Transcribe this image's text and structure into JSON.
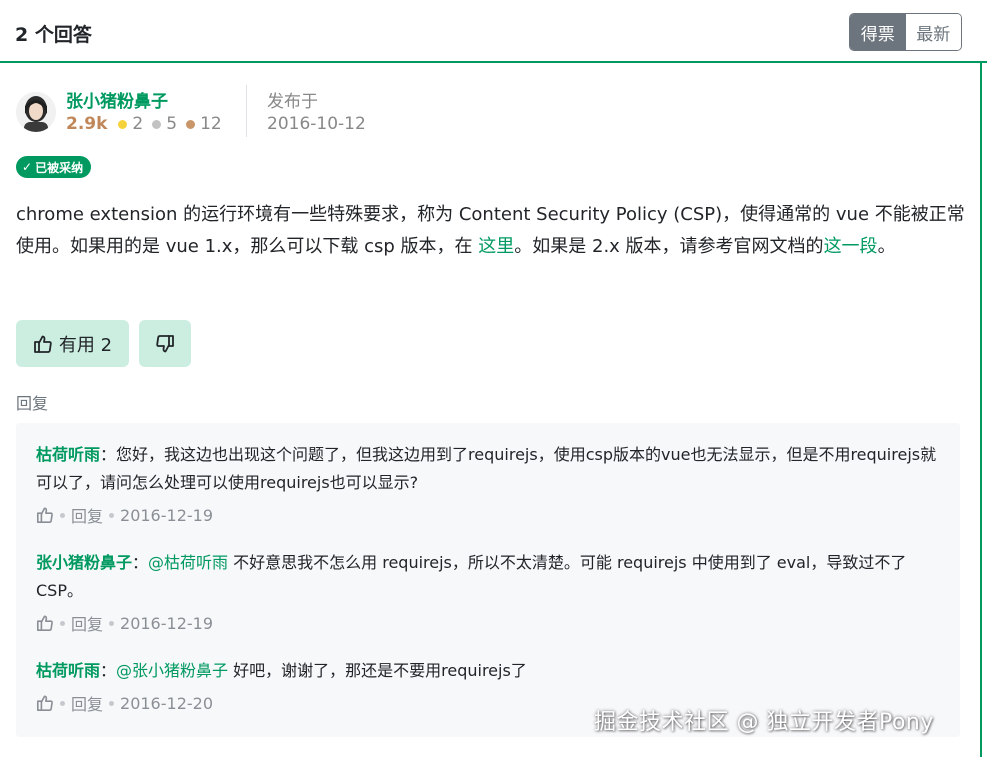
{
  "header": {
    "title": "2 个回答",
    "sort_options": [
      {
        "label": "得票",
        "active": true
      },
      {
        "label": "最新",
        "active": false
      }
    ]
  },
  "answer": {
    "author": {
      "name": "张小猪粉鼻子",
      "reputation": "2.9k",
      "badges": {
        "gold": "2",
        "silver": "5",
        "bronze": "12"
      }
    },
    "published_label": "发布于",
    "published_date": "2016-10-12",
    "accepted_label": "已被采纳",
    "body": {
      "t1": "chrome extension 的运行环境有一些特殊要求，称为 Content Security Policy (CSP)，使得通常的 vue 不能被正常使用。如果用的是 vue 1.x，那么可以下载 csp 版本，在 ",
      "link1": "这里",
      "t2": "。如果是 2.x 版本，请参考官网文档的",
      "link2": "这一段",
      "t3": "。"
    },
    "vote_up_label": "有用 2",
    "reply_label": "回复"
  },
  "comments": [
    {
      "author": "枯荷听雨",
      "sep": "：",
      "mention": "",
      "text": "您好，我这边也出现这个问题了，但我这边用到了requirejs，使用csp版本的vue也无法显示，但是不用requirejs就可以了，请问怎么处理可以使用requirejs也可以显示?",
      "reply": "回复",
      "date": "2016-12-19"
    },
    {
      "author": "张小猪粉鼻子",
      "sep": "：",
      "mention": "@枯荷听雨",
      "text": " 不好意思我不怎么用 requirejs，所以不太清楚。可能 requirejs 中使用到了 eval，导致过不了 CSP。",
      "reply": "回复",
      "date": "2016-12-19"
    },
    {
      "author": "枯荷听雨",
      "sep": "：",
      "mention": "@张小猪粉鼻子",
      "text": " 好吧，谢谢了，那还是不要用requirejs了",
      "reply": "回复",
      "date": "2016-12-20"
    }
  ],
  "watermark": "掘金技术社区 @ 独立开发者Pony",
  "colors": {
    "accent": "#009a61",
    "vote_bg": "#cbeee1",
    "comments_bg": "#f7f8fa"
  }
}
